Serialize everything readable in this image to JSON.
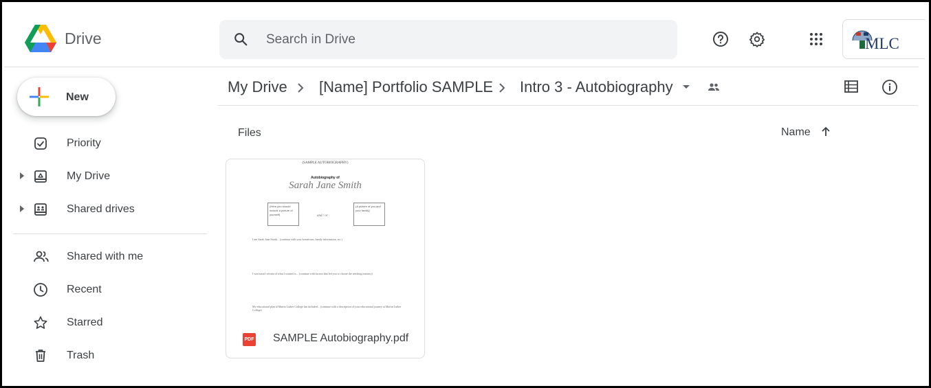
{
  "app": {
    "name": "Drive"
  },
  "search": {
    "placeholder": "Search in Drive"
  },
  "header": {
    "icons": [
      "search-icon",
      "caret-down-icon",
      "help-icon",
      "settings-icon",
      "apps-icon"
    ],
    "account_org": "MLC"
  },
  "sidebar": {
    "new_label": "New",
    "items": [
      {
        "label": "Priority",
        "icon": "checkbox-icon",
        "expandable": false
      },
      {
        "label": "My Drive",
        "icon": "drive-icon",
        "expandable": true
      },
      {
        "label": "Shared drives",
        "icon": "shared-drives-icon",
        "expandable": true
      },
      {
        "label": "Shared with me",
        "icon": "people-icon",
        "expandable": false
      },
      {
        "label": "Recent",
        "icon": "clock-icon",
        "expandable": false
      },
      {
        "label": "Starred",
        "icon": "star-icon",
        "expandable": false
      },
      {
        "label": "Trash",
        "icon": "trash-icon",
        "expandable": false
      }
    ]
  },
  "breadcrumb": {
    "items": [
      "My Drive",
      "[Name] Portfolio SAMPLE",
      "Intro 3 - Autobiography"
    ]
  },
  "files": {
    "heading": "Files",
    "sort_label": "Name",
    "items": [
      {
        "name": "SAMPLE Autobiography.pdf",
        "type_label": "PDF",
        "preview": {
          "title": "(SAMPLE AUTOBIOGRAPHY)",
          "subtitle": "Autobiography of",
          "author": "Sarah Jane Smith",
          "box_left": "(Here you should include a picture of yourself)",
          "and_or": "and / or",
          "box_right": "(A picture of you and your family)",
          "para1": "I am Sarah Jane Smith... (continue with your hometown, family information, etc.)",
          "para2": "I was/wasn't certain of what I wanted to... (continue with factors that led you to choose the teaching ministry)",
          "para3": "My educational plan at Martin Luther College has included... (continue with a description of your educational journey at Martin Luther College)"
        }
      }
    ]
  },
  "colors": {
    "accent_blue": "#1a73e8",
    "pdf_red": "#ea4335",
    "text": "#3c4043",
    "icon_gray": "#5f6368",
    "search_bg": "#f1f3f4"
  }
}
